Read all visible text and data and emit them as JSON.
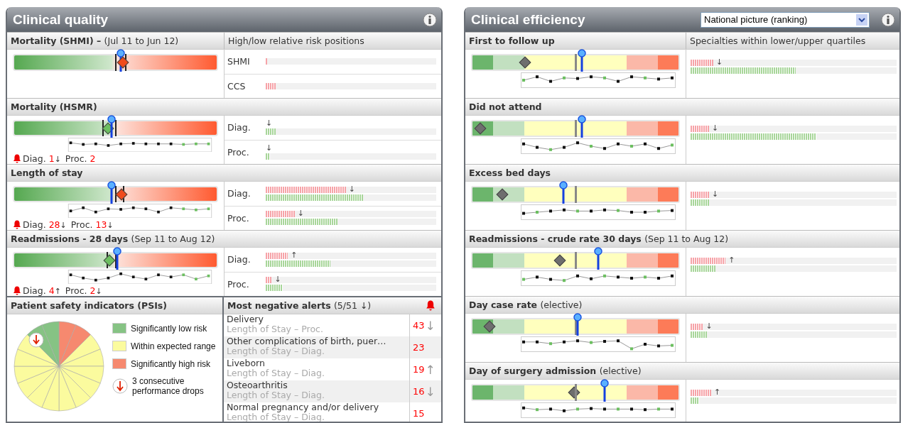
{
  "clinical_quality": {
    "title": "Clinical quality",
    "column_header": "High/low relative risk positions",
    "sections": [
      {
        "title": "Mortality (SHMI) –",
        "subtitle": "(Jul 11 to Jun 12)",
        "trend_chart": false,
        "markers": [
          {
            "kind": "line",
            "level": 0.5
          },
          {
            "kind": "line",
            "level": 0.55
          },
          {
            "kind": "pin",
            "level": 0.525
          },
          {
            "kind": "diamond",
            "level": 0.535,
            "color": "#f04a1c"
          }
        ],
        "rows": [
          {
            "label": "SHMI",
            "bars": [
              {
                "kind": "high",
                "level": 0.01
              }
            ]
          },
          {
            "label": "CCS",
            "bars": [
              {
                "kind": "high",
                "level": 0.06
              }
            ]
          }
        ]
      },
      {
        "title": "Mortality (HSMR)",
        "trend_chart": true,
        "markers": [
          {
            "kind": "line",
            "level": 0.44
          },
          {
            "kind": "line",
            "level": 0.5
          },
          {
            "kind": "diamond",
            "level": 0.46,
            "color": "#6cbf60"
          },
          {
            "kind": "pin",
            "level": 0.48
          }
        ],
        "alerts": [
          {
            "label": "Diag.",
            "count": "1",
            "arrow": "↓"
          },
          {
            "label": "Proc.",
            "count": "2"
          }
        ],
        "rows": [
          {
            "label": "Diag.",
            "arrow": "↓",
            "bars": [
              {
                "kind": "low",
                "level": 0.06
              }
            ]
          },
          {
            "label": "Proc.",
            "arrow": "↓",
            "bars": [
              {
                "kind": "low",
                "level": 0.025
              }
            ]
          }
        ]
      },
      {
        "title": "Length of stay",
        "trend_chart": true,
        "markers": [
          {
            "kind": "line",
            "level": 0.5
          },
          {
            "kind": "line",
            "level": 0.54
          },
          {
            "kind": "pin",
            "level": 0.48
          },
          {
            "kind": "diamond",
            "level": 0.525,
            "color": "#f04a1c"
          }
        ],
        "alerts": [
          {
            "label": "Diag.",
            "count": "28",
            "arrow": "↓"
          },
          {
            "label": "Proc.",
            "count": "13",
            "arrow": "↓"
          }
        ],
        "rows": [
          {
            "label": "Diag.",
            "arrow": "↓",
            "bars": [
              {
                "kind": "high",
                "level": 0.47
              },
              {
                "kind": "low",
                "level": 0.57
              }
            ]
          },
          {
            "label": "Proc.",
            "arrow": "↓",
            "bars": [
              {
                "kind": "high",
                "level": 0.17
              },
              {
                "kind": "low",
                "level": 0.42
              }
            ]
          }
        ]
      },
      {
        "title": "Readmissions - 28 days",
        "subtitle": "(Sep 11 to Aug 12)",
        "trend_chart": true,
        "markers": [
          {
            "kind": "line",
            "level": 0.46
          },
          {
            "kind": "line",
            "level": 0.5
          },
          {
            "kind": "diamond",
            "level": 0.465,
            "color": "#6cbf60"
          },
          {
            "kind": "pin",
            "level": 0.51
          }
        ],
        "alerts": [
          {
            "label": "Diag.",
            "count": "4",
            "arrow": "↑"
          },
          {
            "label": "Proc.",
            "count": "2",
            "arrow": "↓"
          }
        ],
        "rows": [
          {
            "label": "Diag.",
            "arrow": "↑",
            "bars": [
              {
                "kind": "high",
                "level": 0.13
              },
              {
                "kind": "low",
                "level": 0.38
              }
            ]
          },
          {
            "label": "Proc.",
            "arrow": "↓",
            "bars": [
              {
                "kind": "high",
                "level": 0.035
              },
              {
                "kind": "low",
                "level": 0.1
              }
            ]
          }
        ]
      }
    ]
  },
  "patient_safety": {
    "title": "Patient safety indicators (PSIs)",
    "legend": [
      {
        "kind": "swatch",
        "color": "#86c384",
        "label": "Significantly low risk"
      },
      {
        "kind": "swatch",
        "color": "#fbfb9e",
        "label": "Within expected range"
      },
      {
        "kind": "swatch",
        "color": "#f6896f",
        "label": "Significantly high risk"
      },
      {
        "kind": "drop-marker",
        "label": "3 consecutive performance drops"
      }
    ]
  },
  "negative_alerts": {
    "title": "Most negative alerts",
    "subtitle": "(5/51 ↓)",
    "rows": [
      {
        "name": "Delivery",
        "measure": "Length of Stay – Proc.",
        "count": "43",
        "arrow": "↓"
      },
      {
        "name": "Other complications of birth, puer…",
        "measure": "Length of Stay – Diag.",
        "count": "23"
      },
      {
        "name": "Liveborn",
        "measure": "Length of Stay – Diag.",
        "count": "19",
        "arrow": "↑"
      },
      {
        "name": "Osteoarthritis",
        "measure": "Length of Stay – Diag.",
        "count": "16",
        "arrow": "↓"
      },
      {
        "name": "Normal pregnancy and/or delivery",
        "measure": "Length of Stay – Diag.",
        "count": "15"
      }
    ]
  },
  "clinical_efficiency": {
    "title": "Clinical efficiency",
    "select": {
      "value": "National picture (ranking)"
    },
    "column_header": "Specialties within lower/upper quartiles",
    "sections": [
      {
        "title": "First to follow up",
        "markers": [
          {
            "kind": "diamond",
            "level": 0.25,
            "color": "#6e6e6e"
          },
          {
            "kind": "line",
            "level": 0.5
          },
          {
            "kind": "pin",
            "level": 0.53
          }
        ],
        "arrow": "↓",
        "bars": [
          {
            "kind": "high",
            "level": 0.11
          },
          {
            "kind": "low",
            "level": 0.51
          }
        ]
      },
      {
        "title": "Did not attend",
        "markers": [
          {
            "kind": "diamond",
            "level": 0.035,
            "color": "#6e6e6e"
          },
          {
            "kind": "line",
            "level": 0.5
          },
          {
            "kind": "pin",
            "level": 0.53
          }
        ],
        "arrow": "↓",
        "bars": [
          {
            "kind": "high",
            "level": 0.09
          },
          {
            "kind": "low",
            "level": 0.61
          }
        ]
      },
      {
        "title": "Excess bed days",
        "markers": [
          {
            "kind": "diamond",
            "level": 0.14,
            "color": "#6e6e6e"
          },
          {
            "kind": "line",
            "level": 0.5
          },
          {
            "kind": "pin",
            "level": 0.44
          }
        ],
        "arrow": "↓",
        "bars": [
          {
            "kind": "high",
            "level": 0.09
          },
          {
            "kind": "low",
            "level": 0.09
          }
        ]
      },
      {
        "title": "Readmissions - crude rate 30 days",
        "subtitle": "(Sep 11 to Aug 12)",
        "markers": [
          {
            "kind": "diamond",
            "level": 0.42,
            "color": "#6e6e6e"
          },
          {
            "kind": "line",
            "level": 0.5
          },
          {
            "kind": "pin",
            "level": 0.61
          }
        ],
        "arrow": "↑",
        "bars": [
          {
            "kind": "high",
            "level": 0.17
          },
          {
            "kind": "low",
            "level": 0.12
          }
        ]
      },
      {
        "title": "Day case rate",
        "subtitle": "(elective)",
        "markers": [
          {
            "kind": "diamond",
            "level": 0.08,
            "color": "#6e6e6e"
          },
          {
            "kind": "line",
            "level": 0.5
          },
          {
            "kind": "pin",
            "level": 0.51
          }
        ],
        "arrow": "↓",
        "bars": [
          {
            "kind": "high",
            "level": 0.06
          },
          {
            "kind": "low",
            "level": 0.08
          }
        ]
      },
      {
        "title": "Day of surgery admission",
        "subtitle": "(elective)",
        "markers": [
          {
            "kind": "diamond",
            "level": 0.49,
            "color": "#6e6e6e"
          },
          {
            "kind": "line",
            "level": 0.5
          },
          {
            "kind": "pin",
            "level": 0.64
          }
        ],
        "arrow": "↑",
        "bars": [
          {
            "kind": "high",
            "level": 0.1
          },
          {
            "kind": "low",
            "level": 0.04
          }
        ]
      }
    ]
  }
}
